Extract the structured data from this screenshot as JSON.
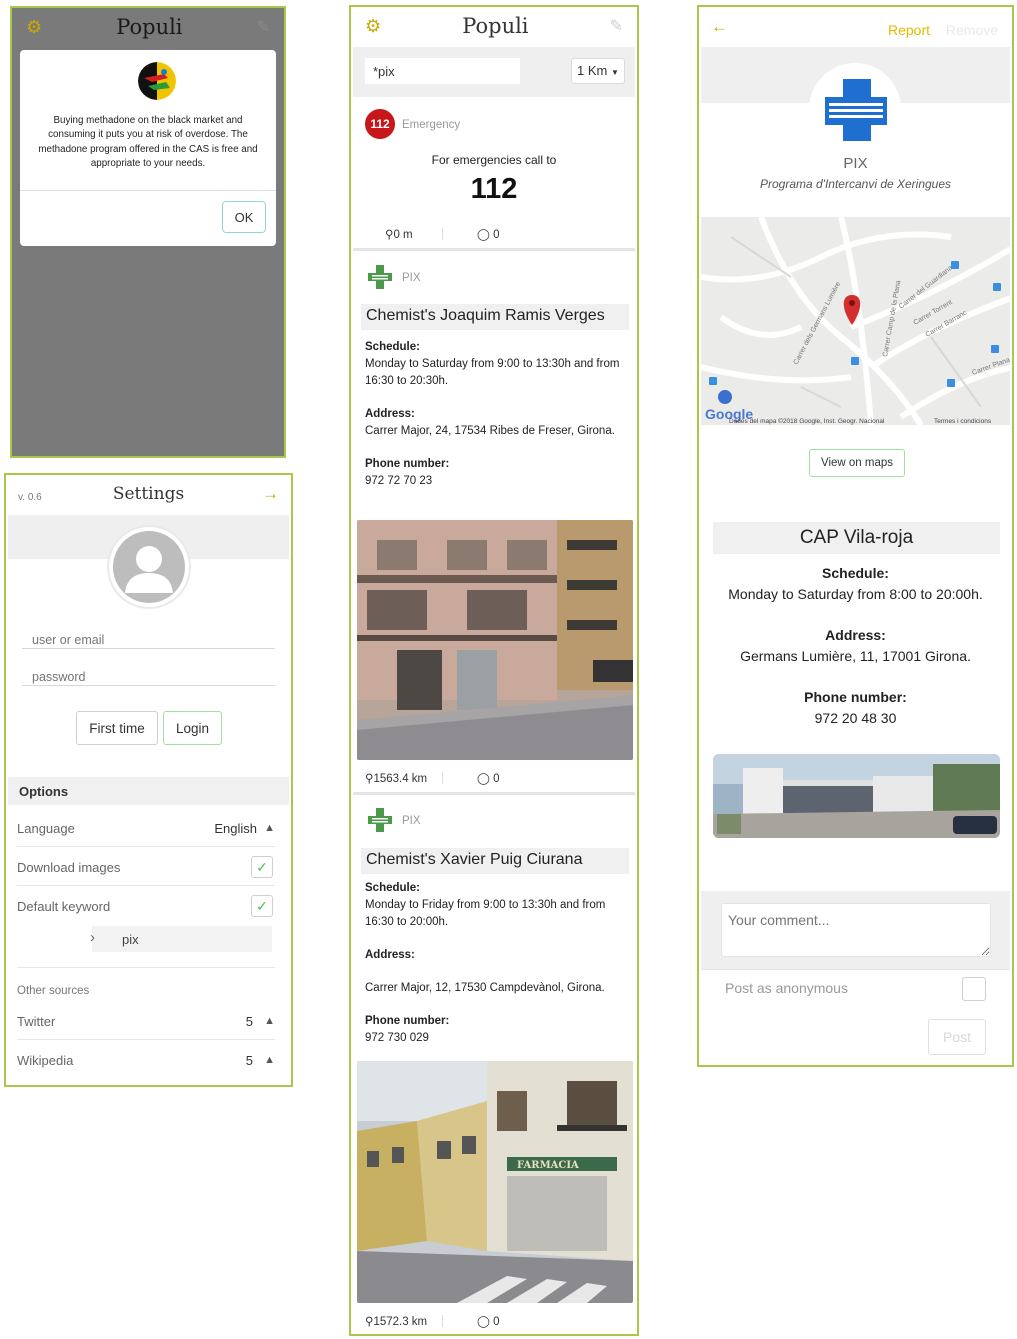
{
  "alert_screen": {
    "app_title": "Populi",
    "dialog_message": "Buying methadone on the black market and consuming it puts you at risk of overdose. The methadone program offered in the CAS is free and appropriate to your needs.",
    "ok_label": "OK"
  },
  "settings": {
    "version": "v. 0.6",
    "title": "Settings",
    "user_placeholder": "user or email",
    "password_placeholder": "password",
    "first_time_label": "First time",
    "login_label": "Login",
    "options_header": "Options",
    "language_label": "Language",
    "language_value": "English",
    "download_images_label": "Download images",
    "default_keyword_label": "Default keyword",
    "keyword_value": "pix",
    "other_sources_header": "Other sources",
    "twitter_label": "Twitter",
    "twitter_value": "5",
    "wikipedia_label": "Wikipedia",
    "wikipedia_value": "5"
  },
  "list_screen": {
    "app_title": "Populi",
    "search_value": "*pix",
    "radius_value": "1 Km",
    "emergency": {
      "badge": "112",
      "category": "Emergency",
      "call_text": "For emergencies call to",
      "number": "112",
      "distance": "0 m",
      "comments": "0"
    },
    "cards": [
      {
        "category": "PIX",
        "title": "Chemist's Joaquim Ramis Verges",
        "schedule_label": "Schedule:",
        "schedule": "Monday to Saturday from 9:00 to 13:30h and from 16:30 to 20:30h.",
        "address_label": "Address:",
        "address": "Carrer Major, 24, 17534 Ribes de Freser, Girona.",
        "phone_label": "Phone number:",
        "phone": "972 72 70 23",
        "distance": "1563.4 km",
        "comments": "0"
      },
      {
        "category": "PIX",
        "title": "Chemist's Xavier Puig Ciurana",
        "schedule_label": "Schedule:",
        "schedule": "Monday to Friday from 9:00 to 13:30h and from 16:30 to 20:00h.",
        "address_label": "Address:",
        "address": "Carrer Major, 12, 17530 Campdevànol, Girona.",
        "phone_label": "Phone number:",
        "phone": "972 730 029",
        "distance": "1572.3 km",
        "comments": "0",
        "shop_sign": "FARMACIA"
      }
    ]
  },
  "detail_screen": {
    "report_label": "Report",
    "remove_label": "Remove",
    "category": "PIX",
    "category_full": "Programa d'Intercanvi de Xeringues",
    "map": {
      "google_logo": "Google",
      "attribution": "Dades del mapa ©2018 Google, Inst. Geogr. Nacional",
      "terms": "Termes i condicions",
      "street_labels": [
        "Carrer dels Germans Lumière",
        "Carrer Camp de la Plana",
        "Carrer del Guardiana",
        "Carrer Torrent",
        "Carrer Barranc",
        "Carrer Plana"
      ]
    },
    "view_maps_label": "View on maps",
    "title": "CAP Vila-roja",
    "schedule_label": "Schedule:",
    "schedule": "Monday to Saturday from 8:00 to 20:00h.",
    "address_label": "Address:",
    "address": "Germans Lumière, 11, 17001 Girona.",
    "phone_label": "Phone number:",
    "phone": "972 20 48 30",
    "comment_placeholder": "Your comment...",
    "anonymous_label": "Post as anonymous",
    "post_label": "Post"
  },
  "colors": {
    "accent": "#c9a800",
    "border": "#a9c84a",
    "emergency_red": "#c8171b",
    "pix_green": "#4a9a4a",
    "pix_blue": "#1e6fd0"
  }
}
